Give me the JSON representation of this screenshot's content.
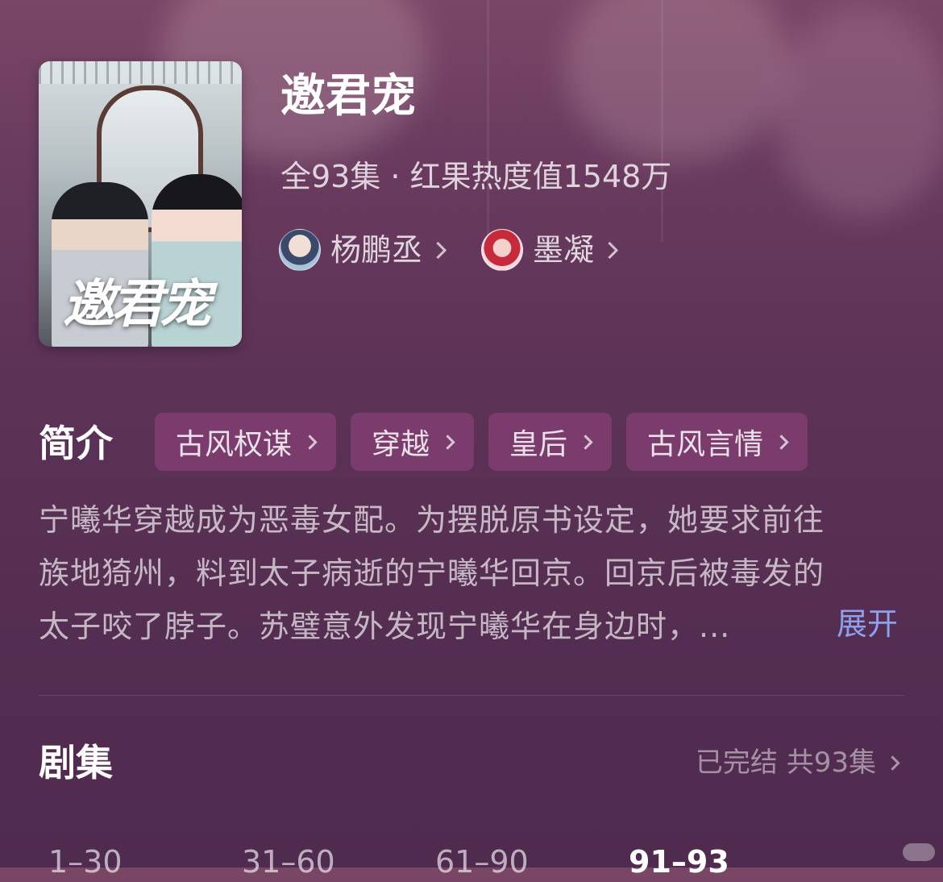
{
  "show": {
    "title": "邀君宠",
    "poster_title": "邀君宠",
    "meta": "全93集 · 红果热度值1548万"
  },
  "cast": [
    {
      "name": "杨鹏丞"
    },
    {
      "name": "墨凝"
    }
  ],
  "intro": {
    "label": "简介",
    "tags": [
      "古风权谋",
      "穿越",
      "皇后",
      "古风言情"
    ],
    "lines": [
      "宁曦华穿越成为恶毒女配。为摆脱原书设定，她要求前往",
      "族地猗州，料到太子病逝的宁曦华回京。回京后被毒发的",
      "太子咬了脖子。苏璧意外发现宁曦华在身边时，..."
    ],
    "expand_label": "展开"
  },
  "episodes": {
    "label": "剧集",
    "status": "已完结 共93集",
    "ranges": [
      "1–30",
      "31–60",
      "61–90",
      "91–93"
    ],
    "active_range": "91–93"
  },
  "colors": {
    "background": "#5e3358",
    "tag_bg": "#8e4680",
    "expand_link": "#8fa0ea"
  }
}
